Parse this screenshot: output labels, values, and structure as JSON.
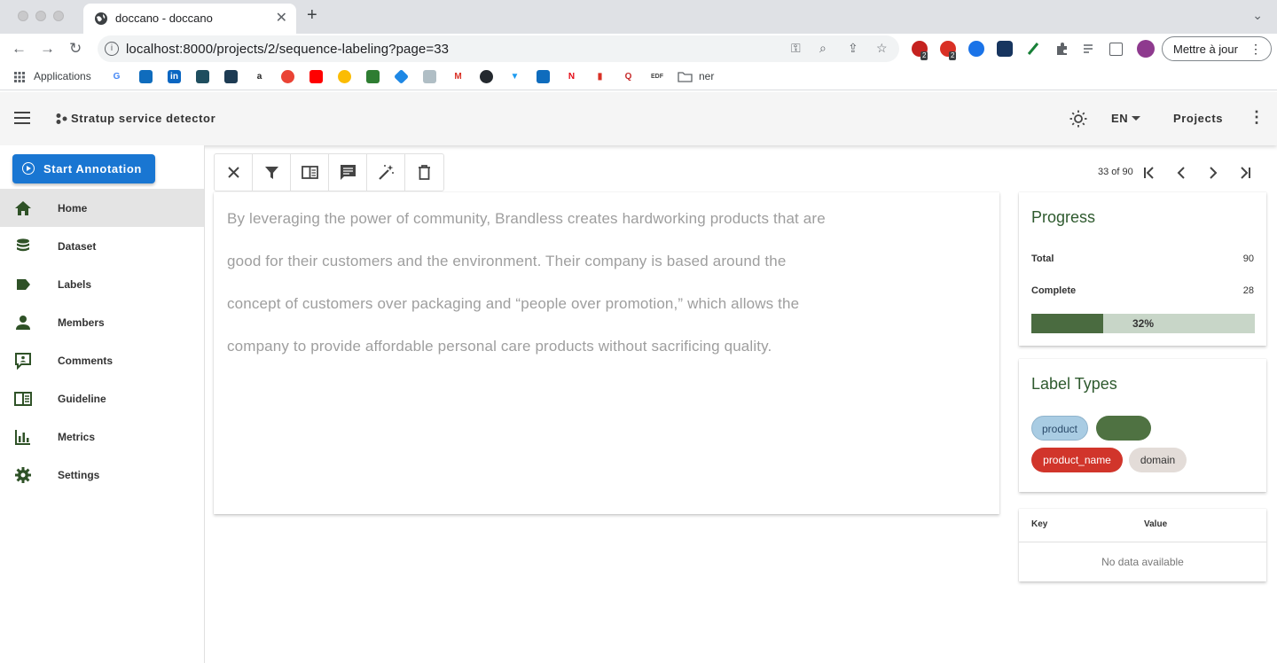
{
  "browser": {
    "tab_title": "doccano - doccano",
    "url": "localhost:8000/projects/2/sequence-labeling?page=33",
    "update_button": "Mettre à jour",
    "bookmarks": {
      "apps_label": "Applications",
      "folder_label": "ner"
    },
    "extension_badges": [
      "2",
      "2"
    ]
  },
  "appbar": {
    "project_title": "Stratup service detector",
    "language": "EN",
    "projects_link": "Projects"
  },
  "sidebar": {
    "start_button": "Start Annotation",
    "items": [
      {
        "label": "Home",
        "icon": "home-icon"
      },
      {
        "label": "Dataset",
        "icon": "database-icon"
      },
      {
        "label": "Labels",
        "icon": "label-icon"
      },
      {
        "label": "Members",
        "icon": "account-icon"
      },
      {
        "label": "Comments",
        "icon": "comment-icon"
      },
      {
        "label": "Guideline",
        "icon": "book-icon"
      },
      {
        "label": "Metrics",
        "icon": "chart-bar-icon"
      },
      {
        "label": "Settings",
        "icon": "cog-icon"
      }
    ]
  },
  "pager": {
    "text": "33 of 90"
  },
  "document": {
    "lines": [
      "By leveraging the power of community, Brandless creates hardworking products that are",
      "good for their customers and the environment. Their company is based around the",
      "concept of customers over packaging and “people over promotion,” which allows the",
      "company to provide affordable personal care products without sacrificing quality."
    ]
  },
  "progress": {
    "title": "Progress",
    "total_label": "Total",
    "total_value": "90",
    "complete_label": "Complete",
    "complete_value": "28",
    "percent_label": "32%",
    "fraction": 0.32
  },
  "label_types": {
    "title": "Label Types",
    "labels": [
      {
        "name": "product",
        "color": "#a9cce3",
        "text_color": "#2a4a6a"
      },
      {
        "name": "",
        "color": "#4f7242",
        "text_color": "#ffffff"
      },
      {
        "name": "product_name",
        "color": "#d1352b",
        "text_color": "#ffffff"
      },
      {
        "name": "domain",
        "color": "#e3dcd8",
        "text_color": "#333333"
      }
    ]
  },
  "metadata_table": {
    "key_header": "Key",
    "value_header": "Value",
    "empty_text": "No data available"
  }
}
